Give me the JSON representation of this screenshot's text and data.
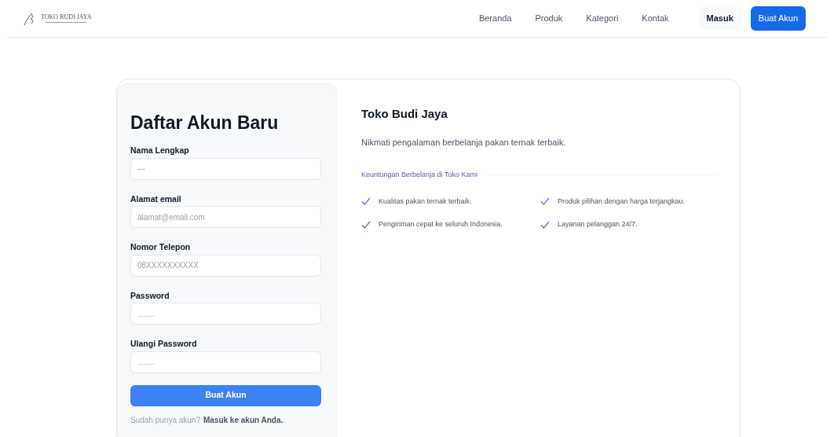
{
  "brand": {
    "name": "TOKO BUDI JAYA"
  },
  "nav": {
    "links": [
      "Beranda",
      "Produk",
      "Kategori",
      "Kontak"
    ],
    "login": "Masuk",
    "register": "Buat Akun"
  },
  "form": {
    "title": "Daftar Akun Baru",
    "fields": [
      {
        "label": "Nama Lengkap",
        "placeholder": "---"
      },
      {
        "label": "Alamat email",
        "placeholder": "alamat@email.com"
      },
      {
        "label": "Nomor Telepon",
        "placeholder": "08XXXXXXXXXX"
      },
      {
        "label": "Password",
        "placeholder": "........"
      },
      {
        "label": "Ulangi Password",
        "placeholder": "........"
      }
    ],
    "submit": "Buat Akun",
    "footer_text": "Sudah punya akun?",
    "footer_link": "Masuk ke akun Anda."
  },
  "info": {
    "title": "Toko Budi Jaya",
    "subtitle": "Nikmati pengalaman berbelanja pakan ternak terbaik.",
    "section": "Keuntungan Berbelanja di Toko Kami",
    "benefits": [
      "Kualitas pakan ternak terbaik.",
      "Produk pilihan dengan harga terjangkau.",
      "Pengiriman cepat ke seluruh Indonesia.",
      "Layanan pelanggan 24/7."
    ]
  }
}
